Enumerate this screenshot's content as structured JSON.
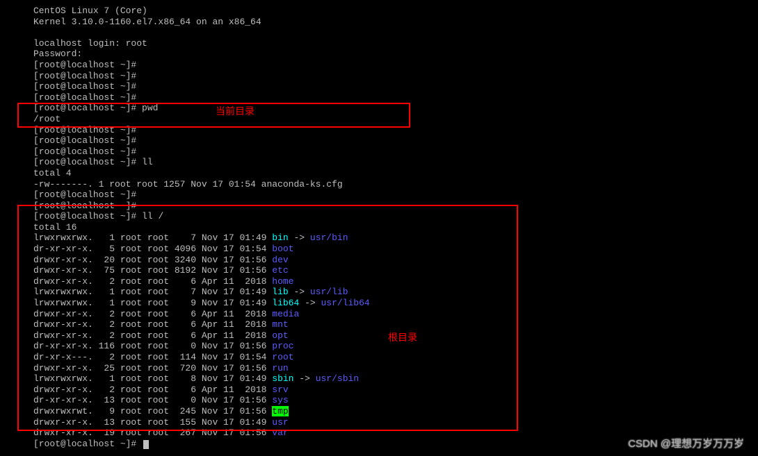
{
  "header": {
    "line1": "CentOS Linux 7 (Core)",
    "line2": "Kernel 3.10.0-1160.el7.x86_64 on an x86_64",
    "loginPrompt": "localhost login: root",
    "passwordPrompt": "Password:"
  },
  "prompt": "[root@localhost ~]#",
  "cmdPwd": "pwd",
  "pwdOutput": "/root",
  "cmdLl": "ll",
  "llOutTotal": "total 4",
  "llOutLine": "-rw-------. 1 root root 1257 Nov 17 01:54 anaconda-ks.cfg",
  "cmdLlRoot": "ll /",
  "llRootTotal": "total 16",
  "rootEntries": [
    {
      "perm": "lrwxrwxrwx.",
      "lnk": "  1",
      "own": "root root",
      "size": "   7",
      "date": "Nov 17 01:49",
      "name": "bin",
      "arrow": " -> ",
      "target": "usr/bin",
      "nameCls": "fg-cyan",
      "targetCls": "fg-blue"
    },
    {
      "perm": "dr-xr-xr-x.",
      "lnk": "  5",
      "own": "root root",
      "size": "4096",
      "date": "Nov 17 01:54",
      "name": "boot",
      "nameCls": "fg-blue"
    },
    {
      "perm": "drwxr-xr-x.",
      "lnk": " 20",
      "own": "root root",
      "size": "3240",
      "date": "Nov 17 01:56",
      "name": "dev",
      "nameCls": "fg-blue"
    },
    {
      "perm": "drwxr-xr-x.",
      "lnk": " 75",
      "own": "root root",
      "size": "8192",
      "date": "Nov 17 01:56",
      "name": "etc",
      "nameCls": "fg-blue"
    },
    {
      "perm": "drwxr-xr-x.",
      "lnk": "  2",
      "own": "root root",
      "size": "   6",
      "date": "Apr 11  2018",
      "name": "home",
      "nameCls": "fg-blue"
    },
    {
      "perm": "lrwxrwxrwx.",
      "lnk": "  1",
      "own": "root root",
      "size": "   7",
      "date": "Nov 17 01:49",
      "name": "lib",
      "arrow": " -> ",
      "target": "usr/lib",
      "nameCls": "fg-cyan",
      "targetCls": "fg-blue"
    },
    {
      "perm": "lrwxrwxrwx.",
      "lnk": "  1",
      "own": "root root",
      "size": "   9",
      "date": "Nov 17 01:49",
      "name": "lib64",
      "arrow": " -> ",
      "target": "usr/lib64",
      "nameCls": "fg-cyan",
      "targetCls": "fg-blue"
    },
    {
      "perm": "drwxr-xr-x.",
      "lnk": "  2",
      "own": "root root",
      "size": "   6",
      "date": "Apr 11  2018",
      "name": "media",
      "nameCls": "fg-blue"
    },
    {
      "perm": "drwxr-xr-x.",
      "lnk": "  2",
      "own": "root root",
      "size": "   6",
      "date": "Apr 11  2018",
      "name": "mnt",
      "nameCls": "fg-blue"
    },
    {
      "perm": "drwxr-xr-x.",
      "lnk": "  2",
      "own": "root root",
      "size": "   6",
      "date": "Apr 11  2018",
      "name": "opt",
      "nameCls": "fg-blue"
    },
    {
      "perm": "dr-xr-xr-x.",
      "lnk": "116",
      "own": "root root",
      "size": "   0",
      "date": "Nov 17 01:56",
      "name": "proc",
      "nameCls": "fg-blue"
    },
    {
      "perm": "dr-xr-x---.",
      "lnk": "  2",
      "own": "root root",
      "size": " 114",
      "date": "Nov 17 01:54",
      "name": "root",
      "nameCls": "fg-blue"
    },
    {
      "perm": "drwxr-xr-x.",
      "lnk": " 25",
      "own": "root root",
      "size": " 720",
      "date": "Nov 17 01:56",
      "name": "run",
      "nameCls": "fg-blue"
    },
    {
      "perm": "lrwxrwxrwx.",
      "lnk": "  1",
      "own": "root root",
      "size": "   8",
      "date": "Nov 17 01:49",
      "name": "sbin",
      "arrow": " -> ",
      "target": "usr/sbin",
      "nameCls": "fg-cyan",
      "targetCls": "fg-blue"
    },
    {
      "perm": "drwxr-xr-x.",
      "lnk": "  2",
      "own": "root root",
      "size": "   6",
      "date": "Apr 11  2018",
      "name": "srv",
      "nameCls": "fg-blue"
    },
    {
      "perm": "dr-xr-xr-x.",
      "lnk": " 13",
      "own": "root root",
      "size": "   0",
      "date": "Nov 17 01:56",
      "name": "sys",
      "nameCls": "fg-blue"
    },
    {
      "perm": "drwxrwxrwt.",
      "lnk": "  9",
      "own": "root root",
      "size": " 245",
      "date": "Nov 17 01:56",
      "name": "tmp",
      "nameCls": "bg-green"
    },
    {
      "perm": "drwxr-xr-x.",
      "lnk": " 13",
      "own": "root root",
      "size": " 155",
      "date": "Nov 17 01:49",
      "name": "usr",
      "nameCls": "fg-blue"
    },
    {
      "perm": "drwxr-xr-x.",
      "lnk": " 19",
      "own": "root root",
      "size": " 267",
      "date": "Nov 17 01:56",
      "name": "var",
      "nameCls": "fg-blue"
    }
  ],
  "annotations": {
    "currentDir": "当前目录",
    "rootDir": "根目录"
  },
  "watermark": "CSDN @理想万岁万万岁"
}
